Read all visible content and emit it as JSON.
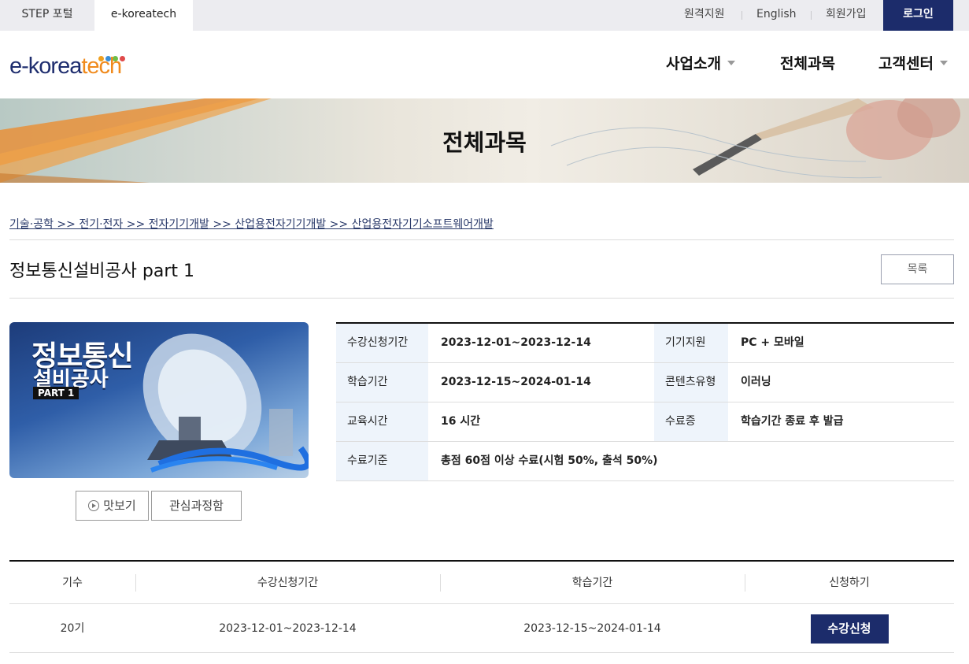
{
  "topbar": {
    "tabs": [
      {
        "label": "STEP 포털"
      },
      {
        "label": "e-koreatech"
      }
    ],
    "util_links": [
      {
        "label": "원격지원"
      },
      {
        "label": "English"
      },
      {
        "label": "회원가입"
      }
    ],
    "login_label": "로그인"
  },
  "header": {
    "logo": {
      "text_main": "e-korea",
      "text_accent": "tech",
      "dot_colors": [
        "#f0a020",
        "#3a8fd9",
        "#6cbf4a",
        "#e04a4a"
      ]
    },
    "nav": [
      {
        "label": "사업소개",
        "has_dropdown": true
      },
      {
        "label": "전체과목",
        "has_dropdown": false
      },
      {
        "label": "고객센터",
        "has_dropdown": true
      }
    ]
  },
  "banner": {
    "title": "전체과목"
  },
  "breadcrumb": "기술·공학 >> 전기·전자 >> 전자기기개발 >> 산업용전자기기개발 >> 산업용전자기기소프트웨어개발",
  "course": {
    "title": "정보통신설비공사 part 1",
    "list_button": "목록",
    "thumbnail": {
      "line1": "정보통신",
      "line2": "설비공사",
      "badge": "PART 1"
    },
    "preview_button": "맛보기",
    "interest_button": "관심과정함",
    "info": {
      "apply_period_label": "수강신청기간",
      "apply_period": "2023-12-01~2023-12-14",
      "device_label": "기기지원",
      "device": "PC + 모바일",
      "study_period_label": "학습기간",
      "study_period": "2023-12-15~2024-01-14",
      "content_type_label": "콘텐츠유형",
      "content_type": "이러닝",
      "edu_hours_label": "교육시간",
      "edu_hours": "16 시간",
      "certificate_label": "수료증",
      "certificate": "학습기간 종료 후 발급",
      "completion_label": "수료기준",
      "completion": "총점 60점 이상 수료(시험 50%, 출석 50%)"
    }
  },
  "sessions": {
    "headers": [
      "기수",
      "수강신청기간",
      "학습기간",
      "신청하기"
    ],
    "rows": [
      {
        "term": "20기",
        "apply_period": "2023-12-01~2023-12-14",
        "study_period": "2023-12-15~2024-01-14",
        "apply_button": "수강신청"
      }
    ]
  },
  "colors": {
    "brand_navy": "#1c2c6b",
    "logo_orange": "#f08a1c",
    "label_bg": "#eef4fb"
  }
}
